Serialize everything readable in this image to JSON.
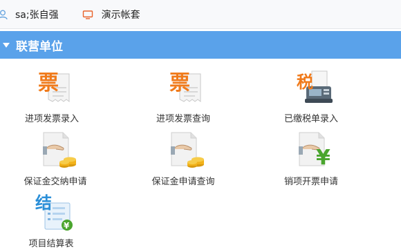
{
  "topbar": {
    "user": "sa;张自强",
    "account": "演示帐套",
    "user_icon": "user-icon",
    "account_icon": "monitor-icon"
  },
  "section": {
    "title": "联营单位",
    "caret_icon": "caret-down-icon"
  },
  "tiles": [
    {
      "label": "进项发票录入",
      "icon": "invoice-icon",
      "glyph": "票"
    },
    {
      "label": "进项发票查询",
      "icon": "invoice-icon",
      "glyph": "票"
    },
    {
      "label": "已缴税单录入",
      "icon": "tax-receipt-icon",
      "glyph": "税"
    },
    {
      "label": "保证金交纳申请",
      "icon": "deposit-icon"
    },
    {
      "label": "保证金申请查询",
      "icon": "deposit-icon"
    },
    {
      "label": "销项开票申请",
      "icon": "yen-document-icon",
      "glyph": "¥"
    },
    {
      "label": "项目结算表",
      "icon": "settlement-icon",
      "glyph": "结"
    }
  ],
  "colors": {
    "header_blue": "#5aa2ea",
    "invoice_orange": "#f07a1a",
    "coin_gold": "#f2b21a",
    "yen_green": "#4aa52e"
  }
}
